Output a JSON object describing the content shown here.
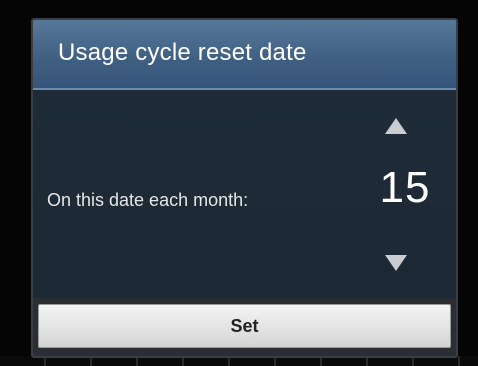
{
  "dialog": {
    "title": "Usage cycle reset date",
    "prompt": "On this date each month:",
    "picker": {
      "value": "15",
      "increment_icon": "triangle-up-icon",
      "decrement_icon": "triangle-down-icon"
    },
    "set_label": "Set"
  },
  "colors": {
    "header": "#3f5f82",
    "body": "#1e2a36",
    "button": "#e3e3e3",
    "text": "#ffffff"
  }
}
